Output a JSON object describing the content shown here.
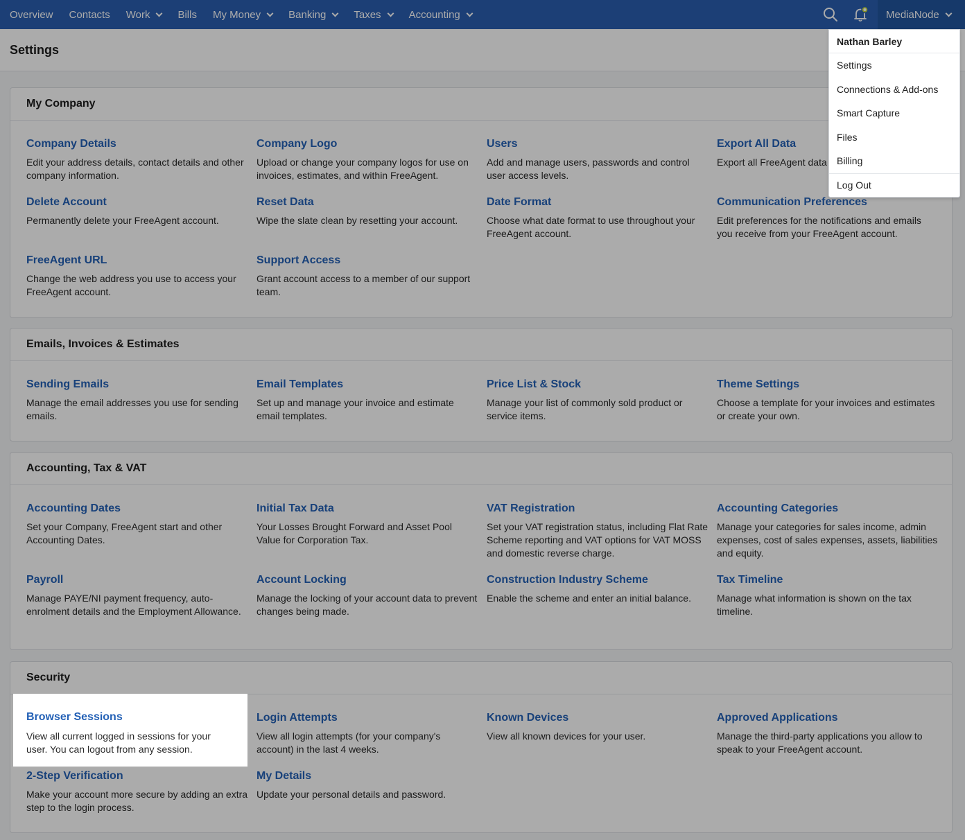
{
  "nav": {
    "items": [
      {
        "label": "Overview",
        "dropdown": false
      },
      {
        "label": "Contacts",
        "dropdown": false
      },
      {
        "label": "Work",
        "dropdown": true
      },
      {
        "label": "Bills",
        "dropdown": false
      },
      {
        "label": "My Money",
        "dropdown": true
      },
      {
        "label": "Banking",
        "dropdown": true
      },
      {
        "label": "Taxes",
        "dropdown": true
      },
      {
        "label": "Accounting",
        "dropdown": true
      }
    ],
    "account_label": "MediaNode",
    "colors": {
      "bar": "#2a5fb0",
      "account": "#22559f",
      "bell_badge": "#c9dc3a"
    }
  },
  "header": {
    "title": "Settings"
  },
  "dropdown": {
    "user_name": "Nathan Barley",
    "items": [
      "Settings",
      "Connections & Add-ons",
      "Smart Capture",
      "Files",
      "Billing"
    ],
    "logout": "Log Out"
  },
  "sections": [
    {
      "title": "My Company",
      "cells": [
        {
          "title": "Company Details",
          "desc": "Edit your address details, contact details and other company information."
        },
        {
          "title": "Company Logo",
          "desc": "Upload or change your company logos for use on invoices, estimates, and within FreeAgent."
        },
        {
          "title": "Users",
          "desc": "Add and manage users, passwords and control user access levels."
        },
        {
          "title": "Export All Data",
          "desc": "Export all FreeAgent data in Excel (XLSX) format."
        },
        {
          "title": "Delete Account",
          "desc": "Permanently delete your FreeAgent account."
        },
        {
          "title": "Reset Data",
          "desc": "Wipe the slate clean by resetting your account."
        },
        {
          "title": "Date Format",
          "desc": "Choose what date format to use throughout your FreeAgent account."
        },
        {
          "title": "Communication Preferences",
          "desc": "Edit preferences for the notifications and emails you receive from your FreeAgent account."
        },
        {
          "title": "FreeAgent URL",
          "desc": "Change the web address you use to access your FreeAgent account."
        },
        {
          "title": "Support Access",
          "desc": "Grant account access to a member of our support team."
        }
      ]
    },
    {
      "title": "Emails, Invoices & Estimates",
      "cells": [
        {
          "title": "Sending Emails",
          "desc": "Manage the email addresses you use for sending emails."
        },
        {
          "title": "Email Templates",
          "desc": "Set up and manage your invoice and estimate email templates."
        },
        {
          "title": "Price List & Stock",
          "desc": "Manage your list of commonly sold product or service items."
        },
        {
          "title": "Theme Settings",
          "desc": "Choose a template for your invoices and estimates or create your own."
        }
      ]
    },
    {
      "title": "Accounting, Tax & VAT",
      "cells": [
        {
          "title": "Accounting Dates",
          "desc": "Set your Company, FreeAgent start and other Accounting Dates."
        },
        {
          "title": "Initial Tax Data",
          "desc": "Your Losses Brought Forward and Asset Pool Value for Corporation Tax."
        },
        {
          "title": "VAT Registration",
          "desc": "Set your VAT registration status, including Flat Rate Scheme reporting and VAT options for VAT MOSS and domestic reverse charge."
        },
        {
          "title": "Accounting Categories",
          "desc": "Manage your categories for sales income, admin expenses, cost of sales expenses, assets, liabilities and equity."
        },
        {
          "title": "Payroll",
          "desc": "Manage PAYE/NI payment frequency, auto-enrolment details and the Employment Allowance."
        },
        {
          "title": "Account Locking",
          "desc": "Manage the locking of your account data to prevent changes being made."
        },
        {
          "title": "Construction Industry Scheme",
          "desc": "Enable the scheme and enter an initial balance."
        },
        {
          "title": "Tax Timeline",
          "desc": "Manage what information is shown on the tax timeline."
        }
      ]
    },
    {
      "title": "Security",
      "cells": [
        {
          "title": "Browser Sessions",
          "desc": "View all current logged in sessions for your user. You can logout from any session."
        },
        {
          "title": "Login Attempts",
          "desc": "View all login attempts (for your company's account) in the last 4 weeks."
        },
        {
          "title": "Known Devices",
          "desc": "View all known devices for your user."
        },
        {
          "title": "Approved Applications",
          "desc": "Manage the third-party applications you allow to speak to your FreeAgent account."
        },
        {
          "title": "2-Step Verification",
          "desc": "Make your account more secure by adding an extra step to the login process."
        },
        {
          "title": "My Details",
          "desc": "Update your personal details and password."
        }
      ]
    }
  ]
}
